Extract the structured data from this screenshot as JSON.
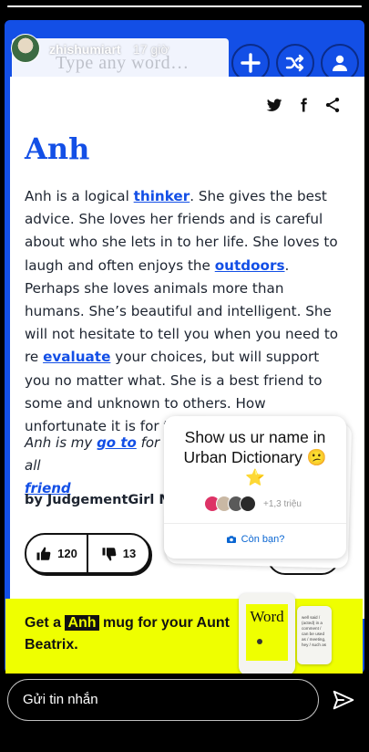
{
  "story": {
    "username": "zhishumiart",
    "time_ago": "17 giờ",
    "progress": 1.0
  },
  "site": {
    "search_placeholder": "Type any word…",
    "accent_color": "#134fe6",
    "promo_color": "#efff00",
    "buttons": [
      "plus-icon",
      "shuffle-icon",
      "user-icon"
    ]
  },
  "share": [
    "twitter-icon",
    "facebook-icon",
    "share-icon"
  ],
  "entry": {
    "word": "Anh",
    "meaning_parts": [
      {
        "t": "Anh is a logical "
      },
      {
        "link": "thinker"
      },
      {
        "t": ". She gives the best advice. She loves her friends and is careful about who she lets in to her life. She loves to laugh and often enjoys the "
      },
      {
        "link": "outdoors"
      },
      {
        "t": ". Perhaps she loves animals more than humans. She’s beautiful and intelligent. She will not hesitate to tell you when you need to re "
      },
      {
        "link": "evaluate"
      },
      {
        "t": " your choices, but will support you no matter what. She is a best friend to some and unknown to others. How unfortunate it is for them not to have an Anh"
      }
    ],
    "example_prefix": "Anh is my ",
    "example_link1": "go to",
    "example_mid": " for all",
    "example_link2": "friend",
    "author": "by JudgementGirl Ma",
    "upvotes": "120",
    "downvotes": "13"
  },
  "promo": {
    "prefix": "Get a ",
    "highlight": "Anh",
    "suffix": " mug for your Aunt Beatrix.",
    "mug_word": "Word",
    "mug_back_text": "well said / (acted) in a comment / can be used as / meeting, hey / such as"
  },
  "sticker": {
    "question": "Show us ur name in Urban Dictionary 😕 ⭐",
    "responders_count": "+1,3 triệu",
    "cta": "Còn bạn?"
  },
  "footer": {
    "message_placeholder": "Gửi tin nhắn"
  }
}
